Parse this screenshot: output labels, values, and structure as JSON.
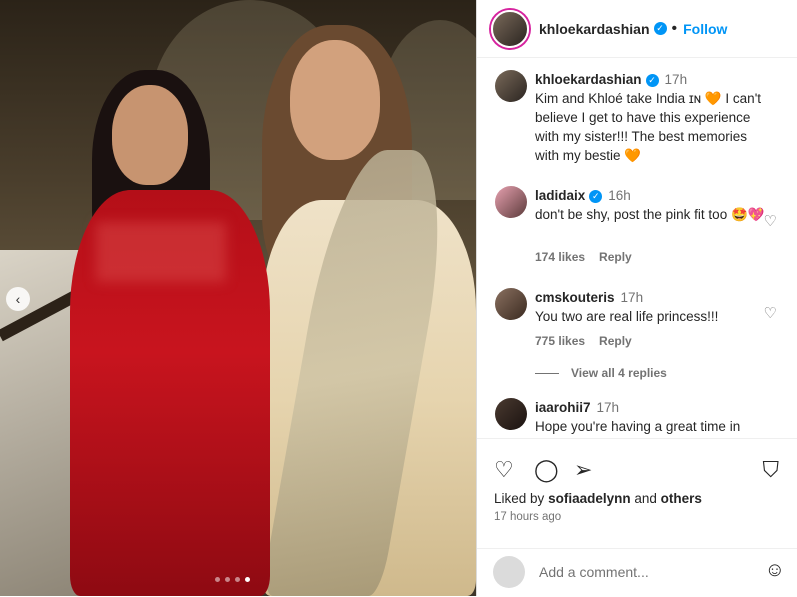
{
  "post": {
    "carousel": {
      "count": 4,
      "active_index": 3
    }
  },
  "header": {
    "username": "khloekardashian",
    "separator": "•",
    "follow_label": "Follow"
  },
  "caption": {
    "username": "khloekardashian",
    "time": "17h",
    "text": "Kim and Khloé take India ɪɴ 🧡 I can't believe I get to have this experience with my sister!!! The best memories with my bestie 🧡"
  },
  "comments": [
    {
      "username": "ladidaix",
      "verified": true,
      "time": "16h",
      "text": "don't be shy, post the pink fit too 🤩💖",
      "likes": "174 likes",
      "reply": "Reply"
    },
    {
      "username": "cmskouteris",
      "verified": false,
      "time": "17h",
      "text": "You two are real life princess!!!",
      "likes": "775 likes",
      "reply": "Reply"
    },
    {
      "username": "iaarohii7",
      "verified": false,
      "time": "17h",
      "text": "Hope you're having a great time in India ❤️ and you are such a great"
    }
  ],
  "view_replies": "View all 4 replies",
  "likes_line": {
    "prefix": "Liked by",
    "user": "sofiaadelynn",
    "middle": "and",
    "suffix": "others"
  },
  "posted_time": "17 hours ago",
  "add_comment": {
    "placeholder": "Add a comment..."
  },
  "icons": {
    "like": "heart-icon",
    "comment": "comment-icon",
    "share": "share-icon",
    "save": "bookmark-icon",
    "emoji": "emoji-icon"
  },
  "colors": {
    "accent": "#0095f6",
    "muted": "#737373",
    "text": "#262626"
  }
}
